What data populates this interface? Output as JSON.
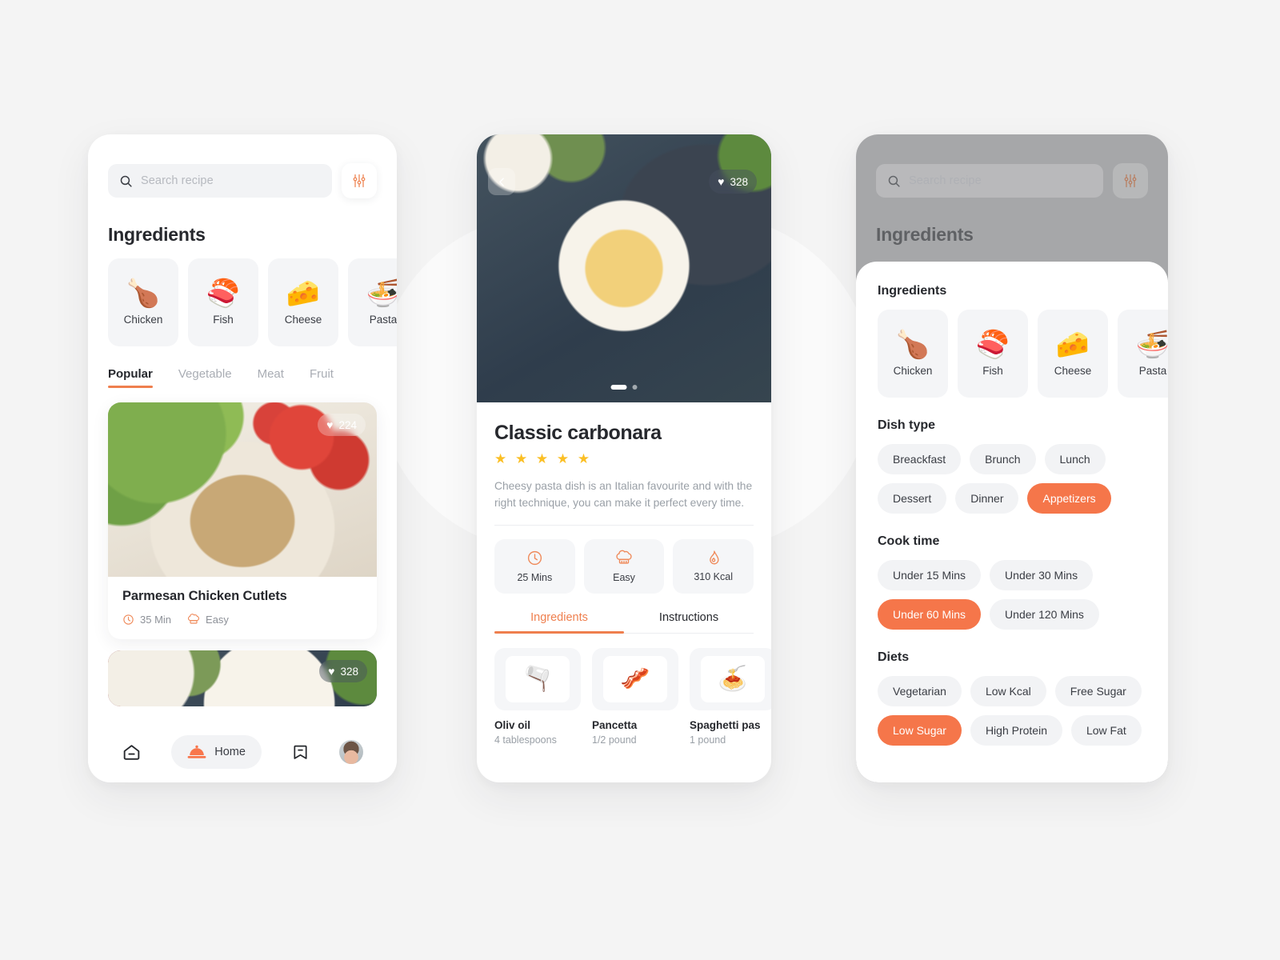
{
  "theme": {
    "accent": "#ef7f4e",
    "accent_chip": "#f5764a",
    "star": "#fbbf24",
    "page_background": "#f4f4f4",
    "surface": "#ffffff",
    "muted_surface": "#f2f3f5",
    "text_primary": "#26282d",
    "text_muted": "#9aa0a7"
  },
  "home_screen": {
    "search": {
      "placeholder": "Search recipe",
      "icon": "search-icon"
    },
    "filter_button": {
      "icon": "sliders-icon"
    },
    "ingredients_title": "Ingredients",
    "ingredients": [
      {
        "name": "Chicken",
        "emoji": "🍗"
      },
      {
        "name": "Fish",
        "emoji": "🍣"
      },
      {
        "name": "Cheese",
        "emoji": "🧀"
      },
      {
        "name": "Pasta",
        "emoji": "🍜"
      }
    ],
    "tabs": [
      {
        "label": "Popular",
        "active": true
      },
      {
        "label": "Vegetable",
        "active": false
      },
      {
        "label": "Meat",
        "active": false
      },
      {
        "label": "Fruit",
        "active": false
      }
    ],
    "recipes": [
      {
        "title": "Parmesan Chicken Cutlets",
        "likes": "224",
        "time": "35 Min",
        "difficulty": "Easy",
        "photo": "parmesan-chicken-cutlets-photo"
      },
      {
        "title": "",
        "likes": "328",
        "photo": "classic-carbonara-photo"
      }
    ],
    "bottom_nav": [
      {
        "name": "home-outline",
        "label": "",
        "active": false,
        "icon": "house-icon"
      },
      {
        "name": "home-pill",
        "label": "Home",
        "active": true,
        "icon": "food-dome-icon"
      },
      {
        "name": "bookmarks",
        "label": "",
        "active": false,
        "icon": "bookmark-icon"
      },
      {
        "name": "profile",
        "label": "",
        "active": false,
        "icon": "avatar-icon"
      }
    ]
  },
  "detail_screen": {
    "back_icon": "chevron-left-icon",
    "hero_likes": "328",
    "carousel": {
      "total": 2,
      "current": 1
    },
    "title": "Classic carbonara",
    "rating": 5,
    "rating_stars": "★ ★ ★ ★ ★",
    "description": "Cheesy pasta dish is an Italian favourite and with the right technique, you can make it perfect every time.",
    "stats": [
      {
        "label": "25 Mins",
        "icon": "clock-icon"
      },
      {
        "label": "Easy",
        "icon": "chef-hat-icon"
      },
      {
        "label": "310 Kcal",
        "icon": "flame-icon"
      }
    ],
    "tabs": [
      {
        "label": "Ingredients",
        "active": true
      },
      {
        "label": "Instructions",
        "active": false
      }
    ],
    "ingredients": [
      {
        "name": "Oliv oil",
        "amount": "4 tablespoons",
        "emoji": "🫗"
      },
      {
        "name": "Pancetta",
        "amount": "1/2 pound",
        "emoji": "🥓"
      },
      {
        "name": "Spaghetti pas",
        "amount": "1 pound",
        "emoji": "🍝"
      }
    ]
  },
  "filter_screen": {
    "backdrop": {
      "search": {
        "placeholder": "Search recipe",
        "icon": "search-icon"
      },
      "filter_button": {
        "icon": "sliders-icon"
      },
      "ingredients_title": "Ingredients"
    },
    "sheet": {
      "ingredients_title": "Ingredients",
      "ingredients": [
        {
          "name": "Chicken",
          "emoji": "🍗"
        },
        {
          "name": "Fish",
          "emoji": "🍣"
        },
        {
          "name": "Cheese",
          "emoji": "🧀"
        },
        {
          "name": "Pasta",
          "emoji": "🍜"
        }
      ],
      "dish_type_title": "Dish type",
      "dish_type": [
        {
          "label": "Breackfast",
          "selected": false
        },
        {
          "label": "Brunch",
          "selected": false
        },
        {
          "label": "Lunch",
          "selected": false
        },
        {
          "label": "Dessert",
          "selected": false
        },
        {
          "label": "Dinner",
          "selected": false
        },
        {
          "label": "Appetizers",
          "selected": true
        }
      ],
      "cook_time_title": "Cook time",
      "cook_time": [
        {
          "label": "Under 15 Mins",
          "selected": false
        },
        {
          "label": "Under 30 Mins",
          "selected": false
        },
        {
          "label": "Under 60 Mins",
          "selected": true
        },
        {
          "label": "Under 120 Mins",
          "selected": false
        }
      ],
      "diets_title": "Diets",
      "diets": [
        {
          "label": "Vegetarian",
          "selected": false
        },
        {
          "label": "Low Kcal",
          "selected": false
        },
        {
          "label": "Free Sugar",
          "selected": false
        },
        {
          "label": "Low Sugar",
          "selected": true
        },
        {
          "label": "High Protein",
          "selected": false
        },
        {
          "label": "Low Fat",
          "selected": false
        }
      ]
    }
  }
}
